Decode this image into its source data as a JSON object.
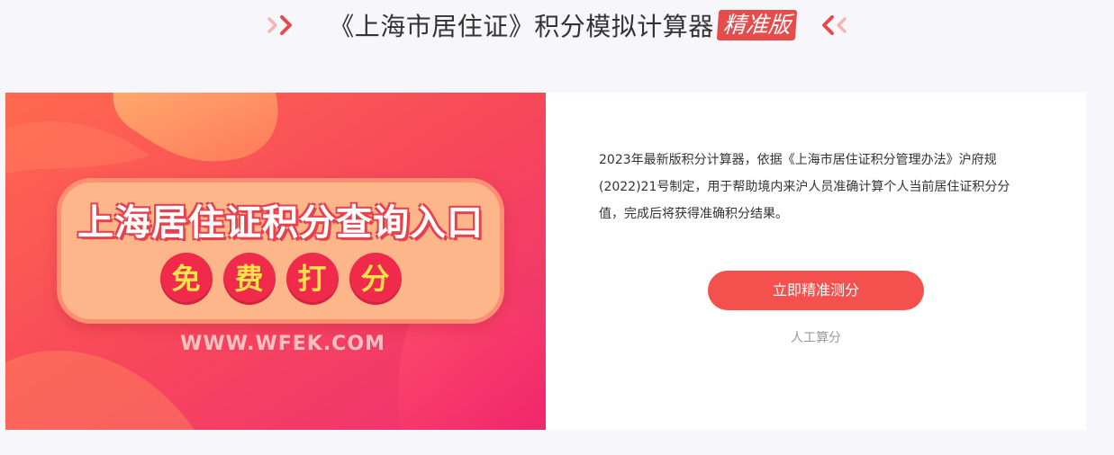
{
  "header": {
    "title": "《上海市居住证》积分模拟计算器",
    "badge": "精准版"
  },
  "banner": {
    "headline": "上海居住证积分查询入口",
    "tagline_chars": [
      "免",
      "费",
      "打",
      "分"
    ],
    "watermark": "WWW.WFEK.COM"
  },
  "info": {
    "description": "2023年最新版积分计算器，依据《上海市居住证积分管理办法》沪府规(2022)21号制定，用于帮助境内来沪人员准确计算个人当前居住证积分分值，完成后将获得准确积分结果。",
    "cta_label": "立即精准测分",
    "manual_label": "人工算分"
  },
  "colors": {
    "accent": "#f4514e",
    "badge_bg": "#e74c4c",
    "page_bg": "#f7f7fb"
  }
}
